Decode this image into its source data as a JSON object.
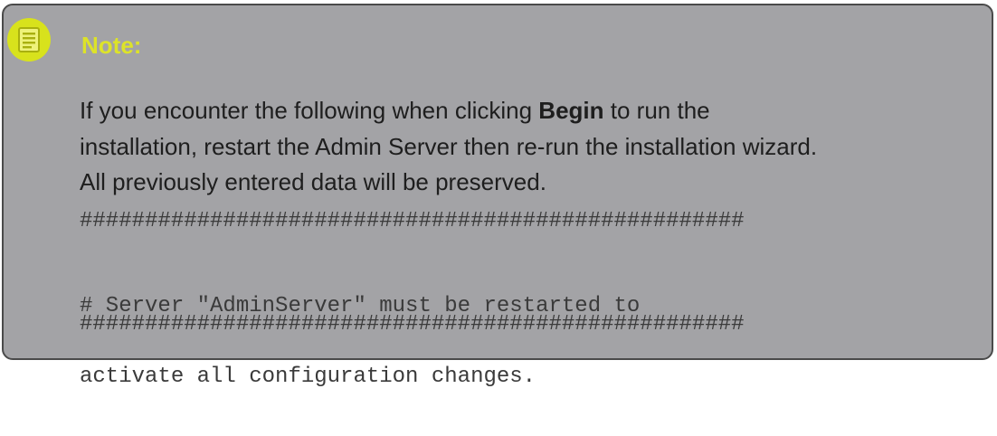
{
  "note": {
    "title": "Note:",
    "icon": "note-icon",
    "accent_color": "#d8e21c",
    "box_color": "#a3a3a6",
    "paragraph1_line1_pre": "If you encounter the following when clicking ",
    "paragraph1_line1_bold": "Begin",
    "paragraph1_line1_post": " to run the",
    "paragraph1_line2": "installation, restart the Admin Server then re-run the installation wizard.",
    "paragraph2": "All previously entered data will be preserved.",
    "code_separator_top": "###################################################",
    "code_message_line1": "# Server \"AdminServer\" must be restarted to",
    "code_message_line2": "activate all configuration changes.",
    "code_separator_bottom": "###################################################"
  }
}
